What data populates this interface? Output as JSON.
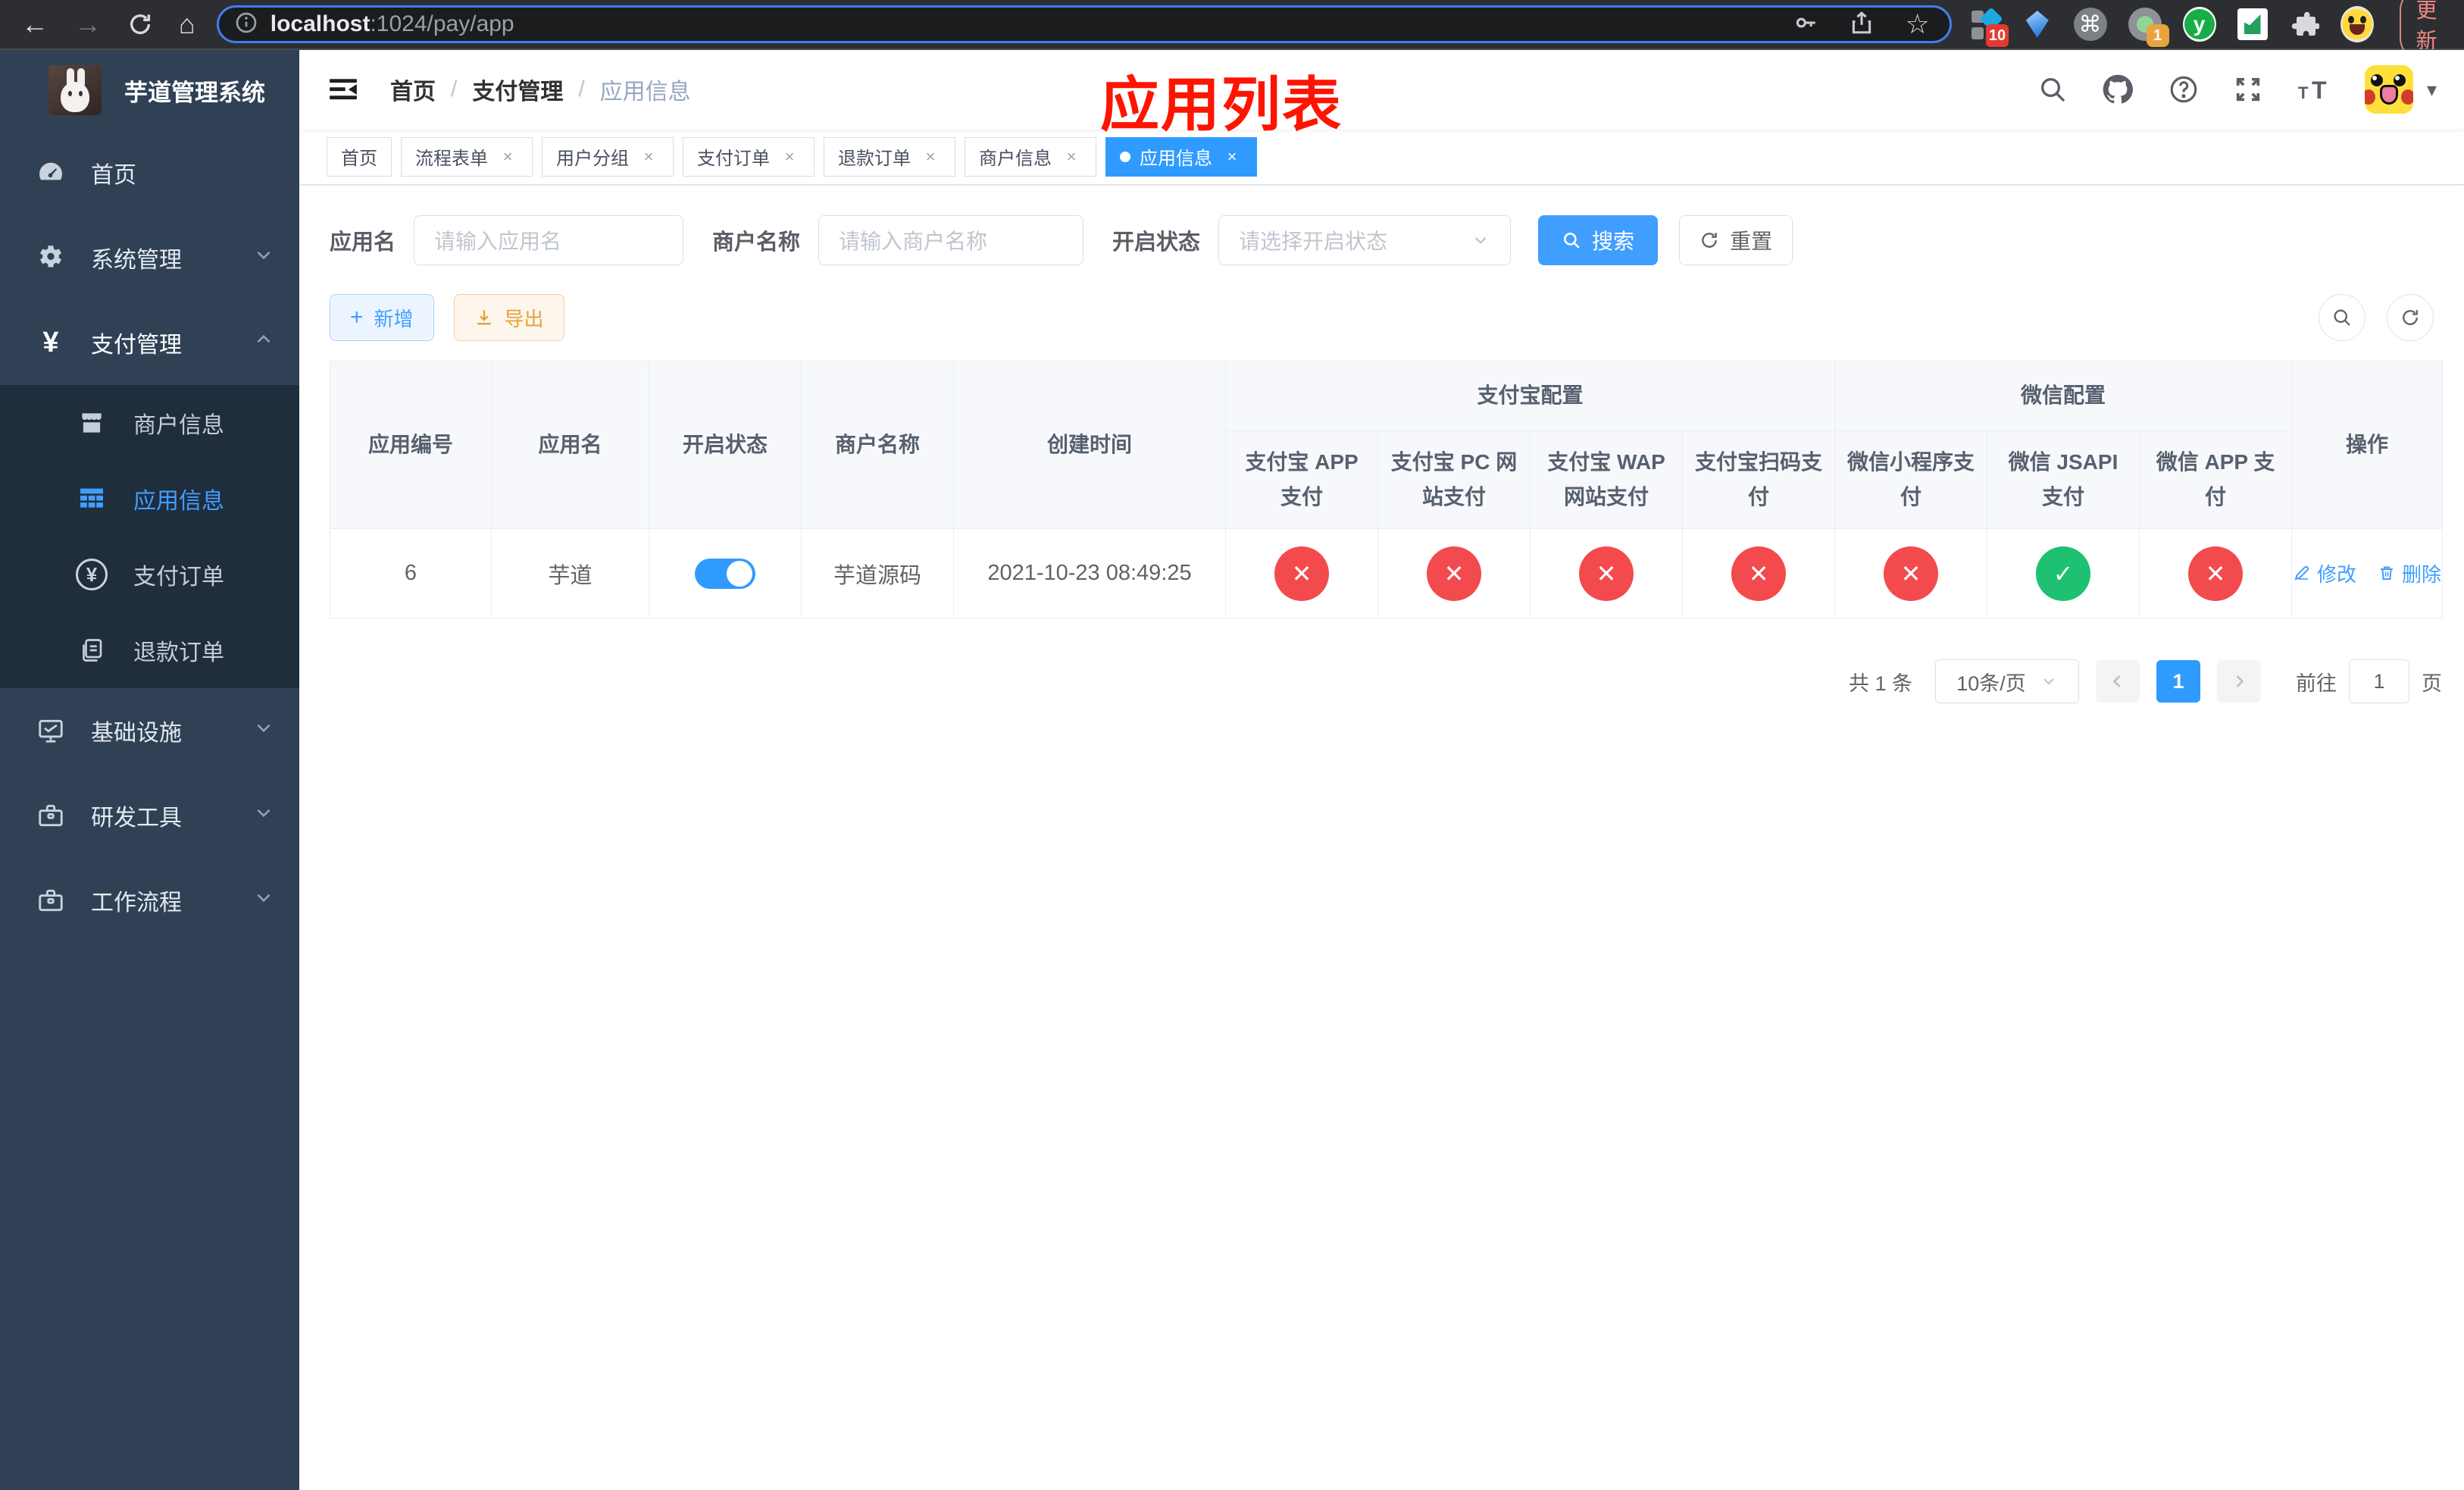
{
  "icons": {
    "back": "←",
    "forward": "→",
    "home": "⌂",
    "star": "☆",
    "command": "⌘",
    "dots": "⋮",
    "caret": "▾",
    "plus": "+",
    "close": "×",
    "slash": "/",
    "check": "✓",
    "cross": "✕",
    "yen": "¥",
    "letter_y": "y"
  },
  "browser": {
    "url_host": "localhost",
    "url_path": ":1024/pay/app",
    "ext_badge_blue": "10",
    "ext_badge_orange": "1",
    "update_label": "更新"
  },
  "sidebar": {
    "logo_title": "芋道管理系统",
    "menu": [
      {
        "label": "首页"
      },
      {
        "label": "系统管理"
      },
      {
        "label": "支付管理"
      }
    ],
    "submenu": [
      {
        "label": "商户信息"
      },
      {
        "label": "应用信息",
        "active": true
      },
      {
        "label": "支付订单"
      },
      {
        "label": "退款订单"
      }
    ],
    "menu_bottom": [
      {
        "label": "基础设施"
      },
      {
        "label": "研发工具"
      },
      {
        "label": "工作流程"
      }
    ]
  },
  "navbar": {
    "breadcrumb": [
      "首页",
      "支付管理",
      "应用信息"
    ]
  },
  "annotation": {
    "text": "应用列表",
    "color": "#fe1400"
  },
  "tabs": [
    {
      "label": "首页",
      "closable": false
    },
    {
      "label": "流程表单",
      "closable": true
    },
    {
      "label": "用户分组",
      "closable": true
    },
    {
      "label": "支付订单",
      "closable": true
    },
    {
      "label": "退款订单",
      "closable": true
    },
    {
      "label": "商户信息",
      "closable": true
    },
    {
      "label": "应用信息",
      "closable": true,
      "active": true
    }
  ],
  "filters": {
    "app_name_label": "应用名",
    "app_name_placeholder": "请输入应用名",
    "merchant_label": "商户名称",
    "merchant_placeholder": "请输入商户名称",
    "status_label": "开启状态",
    "status_placeholder": "请选择开启状态",
    "search_label": "搜索",
    "reset_label": "重置"
  },
  "toolbar": {
    "add_label": "新增",
    "export_label": "导出"
  },
  "table": {
    "columns": [
      "应用编号",
      "应用名",
      "开启状态",
      "商户名称",
      "创建时间"
    ],
    "groups": [
      {
        "label": "支付宝配置",
        "children": [
          "支付宝 APP 支付",
          "支付宝 PC 网站支付",
          "支付宝 WAP 网站支付",
          "支付宝扫码支付"
        ]
      },
      {
        "label": "微信配置",
        "children": [
          "微信小程序支付",
          "微信 JSAPI 支付",
          "微信 APP 支付"
        ]
      }
    ],
    "action_col": "操作",
    "row": {
      "id": "6",
      "name": "芋道",
      "enabled": true,
      "merchant": "芋道源码",
      "created": "2021-10-23 08:49:25",
      "pay_status": [
        "no",
        "no",
        "no",
        "no",
        "no",
        "yes",
        "no"
      ],
      "edit_label": "修改",
      "delete_label": "删除"
    }
  },
  "pagination": {
    "total": "共 1 条",
    "per_page": "10条/页",
    "page": "1",
    "goto_prefix": "前往",
    "goto_value": "1",
    "goto_suffix": "页"
  },
  "colors": {
    "accent": "#409eff",
    "sidebar_bg": "#304156",
    "submenu_bg": "#1f2d3d",
    "status_off": "#f34a4d",
    "status_on": "#1ec170",
    "warning": "#e6a23c"
  }
}
